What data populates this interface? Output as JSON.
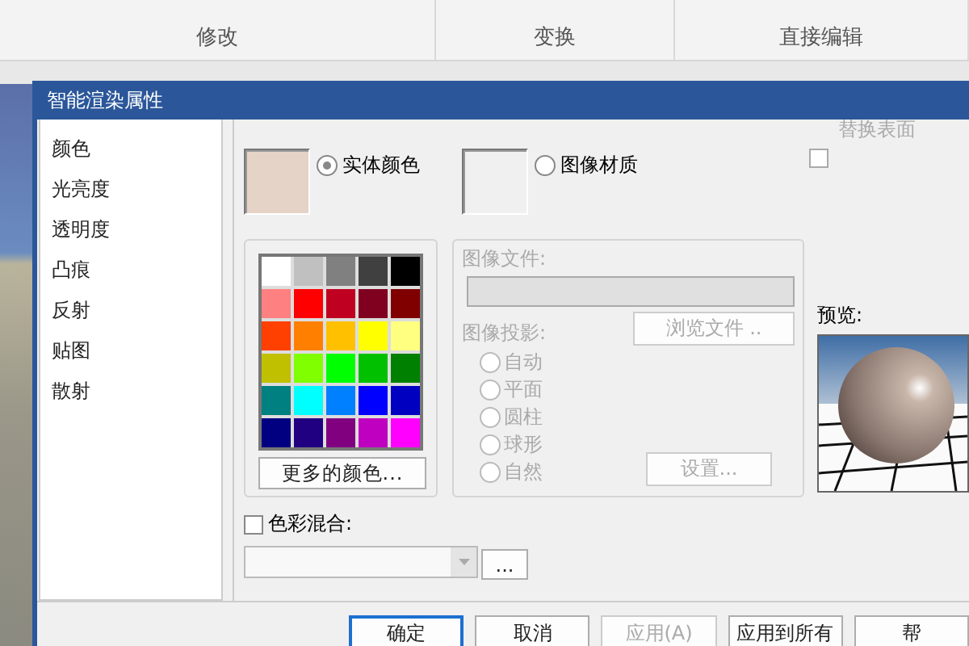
{
  "ribbon": {
    "groups": [
      {
        "label": "修改"
      },
      {
        "label": "变换"
      },
      {
        "label": "直接编辑"
      }
    ]
  },
  "dialog": {
    "title": "智能渲染属性",
    "categories": [
      {
        "label": "颜色"
      },
      {
        "label": "光亮度"
      },
      {
        "label": "透明度"
      },
      {
        "label": "凸痕"
      },
      {
        "label": "反射"
      },
      {
        "label": "贴图"
      },
      {
        "label": "散射"
      }
    ],
    "replace_surface": {
      "label": "替换表面",
      "checked": false
    },
    "material_options": [
      {
        "label": "实体颜色",
        "selected": true,
        "color": "#e4d3c6"
      },
      {
        "label": "图像材质",
        "selected": false,
        "color": "#f0f0f0"
      }
    ],
    "palette": [
      {
        "color": "#ffffff"
      },
      {
        "color": "#c0c0c0"
      },
      {
        "color": "#808080"
      },
      {
        "color": "#404040"
      },
      {
        "color": "#000000"
      },
      {
        "color": "#ff8080"
      },
      {
        "color": "#ff0000"
      },
      {
        "color": "#c00020"
      },
      {
        "color": "#800020"
      },
      {
        "color": "#800000"
      },
      {
        "color": "#ff4000"
      },
      {
        "color": "#ff8000"
      },
      {
        "color": "#ffc000"
      },
      {
        "color": "#ffff00"
      },
      {
        "color": "#ffff80"
      },
      {
        "color": "#c0c000"
      },
      {
        "color": "#80ff00"
      },
      {
        "color": "#00ff00"
      },
      {
        "color": "#00c000"
      },
      {
        "color": "#008000"
      },
      {
        "color": "#008080"
      },
      {
        "color": "#00ffff"
      },
      {
        "color": "#0080ff"
      },
      {
        "color": "#0000ff"
      },
      {
        "color": "#0000c0"
      },
      {
        "color": "#000080"
      },
      {
        "color": "#200080"
      },
      {
        "color": "#800080"
      },
      {
        "color": "#c000c0"
      },
      {
        "color": "#ff00ff"
      }
    ],
    "more_colors_button": "更多的颜色...",
    "image_group": {
      "disabled": true,
      "file_label": "图像文件:",
      "browse_button": "浏览文件 ..",
      "projection_label": "图像投影:",
      "projections": [
        {
          "label": "自动",
          "selected": false
        },
        {
          "label": "平面",
          "selected": false
        },
        {
          "label": "圆柱",
          "selected": false
        },
        {
          "label": "球形",
          "selected": false
        },
        {
          "label": "自然",
          "selected": false
        }
      ],
      "settings_button": "设置..."
    },
    "preview_label": "预览:",
    "blend": {
      "label": "色彩混合:",
      "checked": false,
      "more_button": "..."
    },
    "buttons": [
      {
        "label": "确定",
        "kind": "default",
        "disabled": false
      },
      {
        "label": "取消",
        "kind": "normal",
        "disabled": false
      },
      {
        "label": "应用(A)",
        "kind": "normal",
        "disabled": true
      },
      {
        "label": "应用到所有",
        "kind": "normal",
        "disabled": false
      },
      {
        "label": "帮",
        "kind": "normal",
        "disabled": false
      }
    ]
  }
}
